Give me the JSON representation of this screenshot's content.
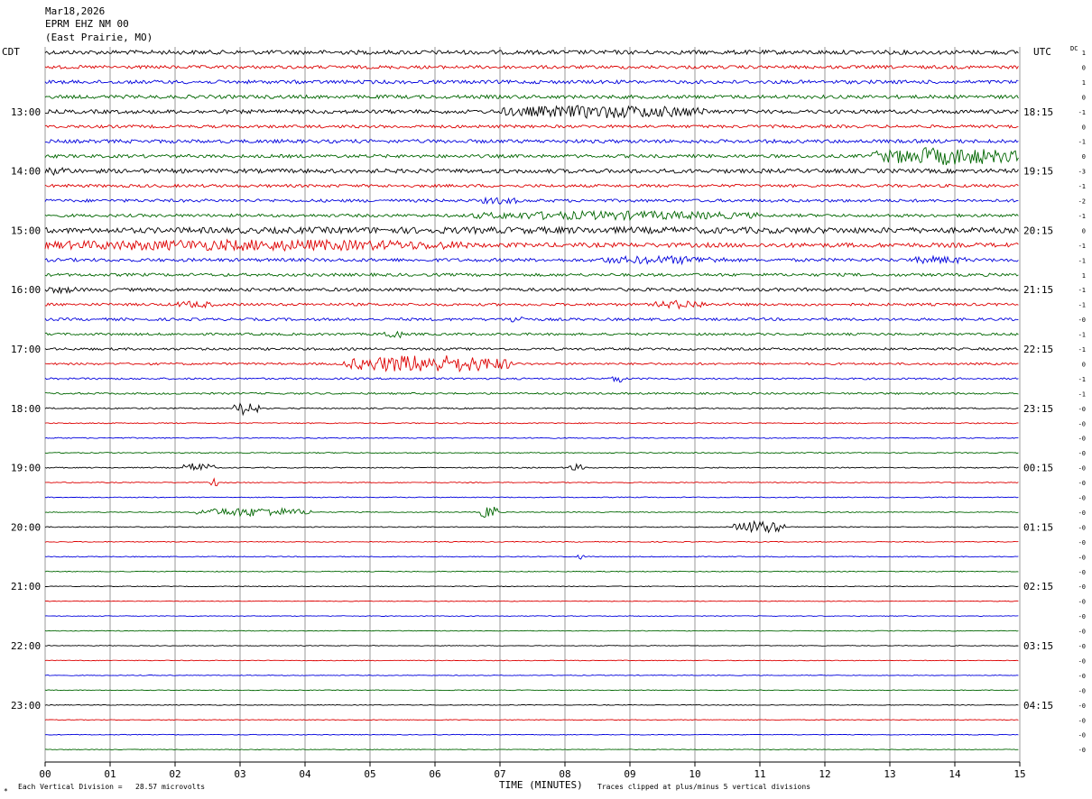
{
  "header": {
    "date": "Mar18,2026",
    "station": "EPRM EHZ NM 00",
    "location": "(East Prairie, MO)"
  },
  "left_zone_label": "CDT",
  "right_zone_label": "UTC",
  "dc_label": "DC",
  "footer": {
    "scale_note": "Each Vertical Division =   28.57 microvolts",
    "xlabel": "TIME (MINUTES)",
    "clip_note": "Traces clipped at plus/minus 5 vertical divisions",
    "corner_mark": "*"
  },
  "colors": {
    "cycle": [
      "#000000",
      "#dd0000",
      "#0000dd",
      "#006600"
    ],
    "grid": "#999999"
  },
  "chart_data": {
    "type": "line",
    "title": "EPRM EHZ NM 00",
    "xlabel": "TIME (MINUTES)",
    "x_ticks": [
      "00",
      "01",
      "02",
      "03",
      "04",
      "05",
      "06",
      "07",
      "08",
      "09",
      "10",
      "11",
      "12",
      "13",
      "14",
      "15"
    ],
    "xlim": [
      0,
      15
    ],
    "trace_count": 48,
    "left_labels": [
      {
        "trace": 4,
        "text": "13:00"
      },
      {
        "trace": 8,
        "text": "14:00"
      },
      {
        "trace": 12,
        "text": "15:00"
      },
      {
        "trace": 16,
        "text": "16:00"
      },
      {
        "trace": 20,
        "text": "17:00"
      },
      {
        "trace": 24,
        "text": "18:00"
      },
      {
        "trace": 28,
        "text": "19:00"
      },
      {
        "trace": 32,
        "text": "20:00"
      },
      {
        "trace": 36,
        "text": "21:00"
      },
      {
        "trace": 40,
        "text": "22:00"
      },
      {
        "trace": 44,
        "text": "23:00"
      }
    ],
    "right_labels": [
      {
        "trace": 4,
        "text": "18:15"
      },
      {
        "trace": 8,
        "text": "19:15"
      },
      {
        "trace": 12,
        "text": "20:15"
      },
      {
        "trace": 16,
        "text": "21:15"
      },
      {
        "trace": 20,
        "text": "22:15"
      },
      {
        "trace": 24,
        "text": "23:15"
      },
      {
        "trace": 28,
        "text": "00:15"
      },
      {
        "trace": 32,
        "text": "01:15"
      },
      {
        "trace": 36,
        "text": "02:15"
      },
      {
        "trace": 40,
        "text": "03:15"
      },
      {
        "trace": 44,
        "text": "04:15"
      }
    ],
    "dc_offsets": [
      "1",
      "0",
      "1",
      "0",
      "-1",
      "0",
      "-1",
      "0",
      "-3",
      "-1",
      "-2",
      "-1",
      "0",
      "-1",
      "-1",
      "1",
      "-1",
      "-1",
      "-0",
      "-1",
      "-1",
      "0",
      "-1",
      "-1",
      "-0",
      "-0",
      "-0",
      "-0",
      "-0",
      "-0",
      "-0",
      "-0",
      "-0",
      "-0",
      "-0",
      "-0",
      "-0",
      "-0",
      "-0",
      "-0",
      "-0",
      "-0",
      "-0",
      "-0",
      "-0",
      "-0",
      "-0",
      "-0"
    ],
    "amplitudes": [
      0.7,
      0.55,
      0.6,
      0.6,
      0.65,
      0.5,
      0.6,
      0.55,
      0.7,
      0.5,
      0.5,
      0.5,
      0.65,
      0.75,
      0.55,
      0.5,
      0.55,
      0.45,
      0.45,
      0.4,
      0.4,
      0.35,
      0.3,
      0.3,
      0.22,
      0.18,
      0.18,
      0.18,
      0.18,
      0.15,
      0.15,
      0.15,
      0.15,
      0.15,
      0.15,
      0.15,
      0.12,
      0.12,
      0.12,
      0.12,
      0.12,
      0.12,
      0.12,
      0.12,
      0.12,
      0.12,
      0.12,
      0.12
    ],
    "events": [
      {
        "trace": 4,
        "start": 7.0,
        "end": 10.2,
        "amp": 2.2
      },
      {
        "trace": 7,
        "start": 12.7,
        "end": 15.0,
        "amp": 3.0
      },
      {
        "trace": 8,
        "start": 0.0,
        "end": 0.4,
        "amp": 1.5
      },
      {
        "trace": 10,
        "start": 6.7,
        "end": 7.3,
        "amp": 1.2
      },
      {
        "trace": 11,
        "start": 6.5,
        "end": 11.0,
        "amp": 1.5
      },
      {
        "trace": 12,
        "start": 0.0,
        "end": 15.0,
        "amp": 1.1
      },
      {
        "trace": 13,
        "start": 0.0,
        "end": 6.5,
        "amp": 1.9
      },
      {
        "trace": 14,
        "start": 8.5,
        "end": 10.5,
        "amp": 1.4
      },
      {
        "trace": 14,
        "start": 13.3,
        "end": 14.2,
        "amp": 1.3
      },
      {
        "trace": 16,
        "start": 0.0,
        "end": 0.5,
        "amp": 1.2
      },
      {
        "trace": 17,
        "start": 9.4,
        "end": 10.2,
        "amp": 1.5
      },
      {
        "trace": 17,
        "start": 2.0,
        "end": 2.6,
        "amp": 1.2
      },
      {
        "trace": 18,
        "start": 7.1,
        "end": 7.4,
        "amp": 1.4
      },
      {
        "trace": 19,
        "start": 5.2,
        "end": 5.5,
        "amp": 1.6
      },
      {
        "trace": 21,
        "start": 4.6,
        "end": 7.2,
        "amp": 3.0
      },
      {
        "trace": 22,
        "start": 8.7,
        "end": 8.9,
        "amp": 1.5
      },
      {
        "trace": 24,
        "start": 2.9,
        "end": 3.3,
        "amp": 2.5
      },
      {
        "trace": 28,
        "start": 2.1,
        "end": 2.6,
        "amp": 1.6
      },
      {
        "trace": 28,
        "start": 8.0,
        "end": 8.3,
        "amp": 1.3
      },
      {
        "trace": 29,
        "start": 2.55,
        "end": 2.65,
        "amp": 2.0
      },
      {
        "trace": 31,
        "start": 2.3,
        "end": 4.1,
        "amp": 1.5
      },
      {
        "trace": 31,
        "start": 6.7,
        "end": 7.0,
        "amp": 2.5
      },
      {
        "trace": 32,
        "start": 10.6,
        "end": 11.4,
        "amp": 2.2
      },
      {
        "trace": 34,
        "start": 8.2,
        "end": 8.3,
        "amp": 1.5
      }
    ]
  }
}
